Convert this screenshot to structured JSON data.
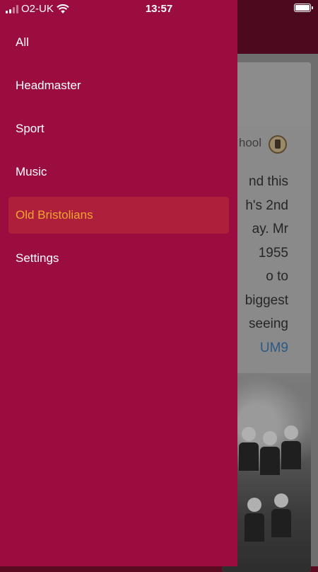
{
  "status_bar": {
    "carrier": "O2-UK",
    "time": "13:57"
  },
  "drawer": {
    "items": [
      {
        "label": "All",
        "active": false
      },
      {
        "label": "Headmaster",
        "active": false
      },
      {
        "label": "Sport",
        "active": false
      },
      {
        "label": "Music",
        "active": false
      },
      {
        "label": "Old Bristolians",
        "active": true
      },
      {
        "label": "Settings",
        "active": false
      }
    ]
  },
  "background_post": {
    "author_fragment": "hool",
    "text_lines": [
      "nd this",
      "h's 2nd",
      "ay. Mr",
      "1955",
      "o to",
      "biggest",
      "seeing"
    ],
    "link_fragment": "UM9"
  },
  "colors": {
    "drawer_bg": "#9b0d3f",
    "active_item_bg": "#ad1f3a",
    "active_item_text": "#f2a531",
    "header_bg": "#4d0a1f"
  }
}
